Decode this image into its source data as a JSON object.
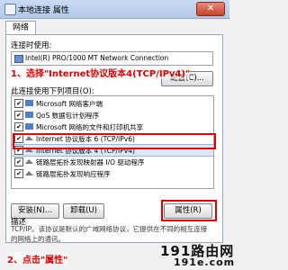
{
  "window": {
    "title": "本地连接 属性",
    "close_label": "✕"
  },
  "tabs": [
    {
      "label": "网络"
    }
  ],
  "connect_using_label": "连接时使用:",
  "adapter_name": "Intel(R) PRO/1000 MT Network Connection",
  "configure_button": "配置(C)...",
  "items_label": "此连接使用下列项目(O):",
  "list_items": [
    {
      "label": "Microsoft 网络客户端",
      "checked": true,
      "icon": "network-client-icon"
    },
    {
      "label": "QoS 数据包计划程序",
      "checked": true,
      "icon": "qos-icon"
    },
    {
      "label": "Microsoft 网络的文件和打印机共享",
      "checked": true,
      "icon": "file-share-icon"
    },
    {
      "label": "Internet 协议版本 6 (TCP/IPv6)",
      "checked": true,
      "icon": "protocol-icon"
    },
    {
      "label": "Internet 协议版本 4 (TCP/IPv4)",
      "checked": true,
      "icon": "protocol-icon",
      "selected": true
    },
    {
      "label": "链路层拓扑发现映射器 I/O 驱动程序",
      "checked": true,
      "icon": "protocol-icon"
    },
    {
      "label": "链路层拓扑发现响应程序",
      "checked": true,
      "icon": "protocol-icon"
    }
  ],
  "install_button": "安装(N)...",
  "uninstall_button": "卸载(U)",
  "properties_button": "属性(R)",
  "description": {
    "label": "描述",
    "text": "TCP/IP。该协议是默认的广域网络协议，它提供在不同的相互连接的网络上的通讯。"
  },
  "annotations": {
    "step1": "1、选择\"Internet协议版本4(TCP/IPv4)\"",
    "step2": "2、点击\"属性\""
  },
  "watermark": {
    "line1": "191路由网",
    "line2": "191e.com"
  },
  "colors": {
    "annotation": "#e00000",
    "selection": "#dce8f8"
  }
}
